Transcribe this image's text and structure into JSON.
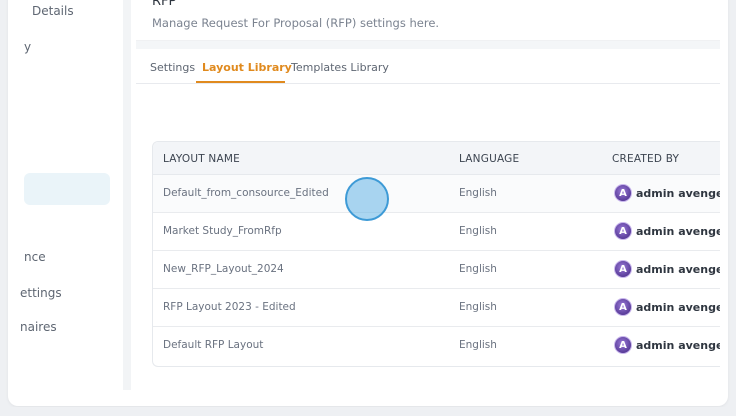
{
  "sidebar": {
    "items": [
      {
        "label": "Details"
      },
      {
        "label": "y"
      },
      {
        "label": "nce"
      },
      {
        "label": "ettings"
      },
      {
        "label": "naires"
      }
    ]
  },
  "header": {
    "title": "RFP",
    "description": "Manage Request For Proposal (RFP) settings here."
  },
  "tabs": [
    {
      "label": "Settings"
    },
    {
      "label": "Layout Library"
    },
    {
      "label": "Templates Library"
    }
  ],
  "table": {
    "columns": [
      "LAYOUT NAME",
      "LANGUAGE",
      "CREATED BY"
    ],
    "rows": [
      {
        "name": "Default_from_consource_Edited",
        "language": "English",
        "created_by": "admin avengers"
      },
      {
        "name": "Market Study_FromRfp",
        "language": "English",
        "created_by": "admin avengers"
      },
      {
        "name": "New_RFP_Layout_2024",
        "language": "English",
        "created_by": "admin avengers"
      },
      {
        "name": "RFP Layout 2023 - Edited",
        "language": "English",
        "created_by": "admin avengers"
      },
      {
        "name": "Default RFP Layout",
        "language": "English",
        "created_by": "admin avengers"
      }
    ]
  },
  "colors": {
    "accent": "#e08a1e",
    "avatar": "#5a3d9a",
    "cursor": "#3d9ad6"
  },
  "icons": {
    "avatar": "avengers-avatar-icon"
  }
}
